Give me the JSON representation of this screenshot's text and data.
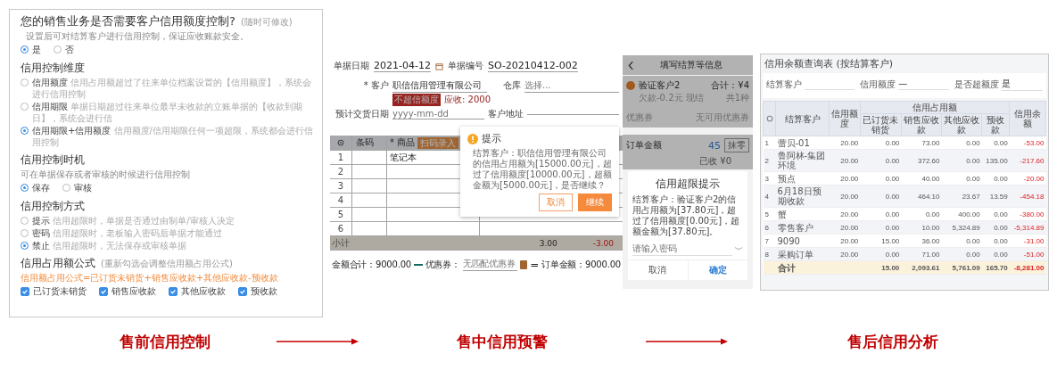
{
  "settings": {
    "title": "您的销售业务是否需要客户信用额度控制?",
    "title_hint": "(随时可修改)",
    "description": "设置后可对结算客户进行信用控制，保证应收账款安全。",
    "enable_options": [
      {
        "label": "是",
        "selected": true
      },
      {
        "label": "否",
        "selected": false
      }
    ],
    "sections": [
      {
        "kind": "radio_list",
        "heading": "信用控制维度",
        "options": [
          {
            "label": "信用额度",
            "description": "信用占用额超过了往来单位档案设置的【信用额度】，系统会进行信用控制",
            "selected": false
          },
          {
            "label": "信用期限",
            "description": "单据日期超过往来单位最早未收款的立账单据的【收款到期日】，系统会进行信",
            "selected": false
          },
          {
            "label": "信用期限+信用额度",
            "description": "信用额度/信用期限任何一项超限，系统都会进行信用控制",
            "selected": true
          }
        ]
      },
      {
        "kind": "radio_inline",
        "heading": "信用控制时机",
        "description": "可在单据保存或者审核的时候进行信用控制",
        "options": [
          {
            "label": "保存",
            "selected": true
          },
          {
            "label": "审核",
            "selected": false
          }
        ]
      },
      {
        "kind": "radio_list",
        "heading": "信用控制方式",
        "options": [
          {
            "label": "提示",
            "description": "信用超限时，单据是否通过由制单/审核人决定",
            "selected": false
          },
          {
            "label": "密码",
            "description": "信用超限时，老板输入密码后单据才能通过",
            "selected": false
          },
          {
            "label": "禁止",
            "description": "信用超限时，无法保存或审核单据",
            "selected": true
          }
        ]
      },
      {
        "kind": "checkbox_formula",
        "heading": "信用占用额公式",
        "heading_hint": "(重新勾选会调整信用额占用公式)",
        "formula": "信用额占用公式=已订货未销货+销售应收款+其他应收款-预收款",
        "options": [
          {
            "label": "已订货未销货",
            "checked": true
          },
          {
            "label": "销售应收款",
            "checked": true
          },
          {
            "label": "其他应收款",
            "checked": true
          },
          {
            "label": "预收款",
            "checked": true
          }
        ]
      }
    ]
  },
  "order_screen": {
    "date_label": "单据日期",
    "date": "2021-04-12",
    "number_label": "单据编号",
    "number": "SO-20210412-002",
    "customer_label": "* 客户",
    "customer": "职信信用管理有限公司",
    "credit_tag": "不超信额度",
    "receivable": "应收: 2000",
    "warehouse_label": "仓库",
    "warehouse_placeholder": "选择...",
    "delivery_label": "预计交货日期",
    "delivery_placeholder": "yyyy-mm-dd",
    "address_label": "客户地址",
    "columns": [
      "条码",
      "* 商品"
    ],
    "scan_button": "扫码录入",
    "rows": [
      {
        "index": "1",
        "product": "笔记本"
      },
      {
        "index": "2",
        "product": ""
      },
      {
        "index": "3",
        "product": ""
      },
      {
        "index": "4",
        "product": ""
      },
      {
        "index": "5",
        "product": ""
      },
      {
        "index": "6",
        "product": ""
      }
    ],
    "subtotal_label": "小计",
    "subtotal_values": [
      "3.00",
      "-3.00"
    ],
    "amount_total": "金额合计：9000.00",
    "coupon_label": "优惠券：",
    "coupon_placeholder": "无匹配优惠券",
    "equals": "=",
    "order_amount": "订单金额：9000.00",
    "dialog": {
      "title": "提示",
      "message": "结算客户：职信信用管理有限公司的信用占用额为[15000.00元]，超过了信用额度[10000.00元]，超额金额为[5000.00元]，是否继续？",
      "buttons": [
        {
          "label": "取消",
          "kind": "secondary"
        },
        {
          "label": "继续",
          "kind": "primary"
        }
      ]
    }
  },
  "mobile_screen": {
    "title": "填写结算等信息",
    "customer": "验证客户2",
    "customer_note": "欠款-0.2元 现结",
    "total": "合计：¥4",
    "count": "共1种",
    "coupon_label": "优惠券",
    "coupon_value": "无可用优惠券",
    "order_amount_label": "订单金额",
    "order_amount": "45",
    "round_button": "抹零",
    "received": "已收 ¥0",
    "dialog": {
      "title": "信用超限提示",
      "message": "结算客户：验证客户2的信用占用额为[37.80元]，超过了信用额度[0.00元]，超额金额为[37.80元]。",
      "password_placeholder": "请输入密码",
      "buttons": [
        {
          "label": "取消",
          "kind": "secondary"
        },
        {
          "label": "确定",
          "kind": "primary"
        }
      ]
    }
  },
  "report": {
    "title": "信用余额查询表 (按结算客户)",
    "filters": [
      {
        "label": "结算客户"
      },
      {
        "label": "信用额度",
        "value": "—"
      },
      {
        "label": "是否超额度",
        "value": "是"
      }
    ],
    "header_rows": [
      [
        {
          "label": "结算客户",
          "rowspan": 2
        },
        {
          "label": "信用额度",
          "rowspan": 2
        },
        {
          "label": "信用占用额",
          "colspan": 4
        },
        {
          "label": "信用余额",
          "rowspan": 2
        }
      ],
      [
        {
          "label": "已订货未销货"
        },
        {
          "label": "销售应收款"
        },
        {
          "label": "其他应收款"
        },
        {
          "label": "预收款"
        }
      ]
    ],
    "rows": [
      {
        "index": "1",
        "cells": [
          "蕾贝-01",
          "20.00",
          "0.00",
          "73.00",
          "0.00",
          "0.00",
          "-53.00"
        ]
      },
      {
        "index": "2",
        "cells": [
          "鲁阿林-集团环境",
          "20.00",
          "0.00",
          "372.60",
          "0.00",
          "135.00",
          "-217.60"
        ]
      },
      {
        "index": "3",
        "cells": [
          "预点",
          "20.00",
          "0.00",
          "40.00",
          "0.00",
          "0.00",
          "-20.00"
        ]
      },
      {
        "index": "4",
        "cells": [
          "6月18日预期收款",
          "20.00",
          "0.00",
          "464.10",
          "23.67",
          "13.59",
          "-454.18"
        ]
      },
      {
        "index": "5",
        "cells": [
          "蟹",
          "20.00",
          "0.00",
          "0.00",
          "400.00",
          "0.00",
          "-380.00"
        ]
      },
      {
        "index": "6",
        "cells": [
          "零售客户",
          "20.00",
          "0.00",
          "10.00",
          "5,324.89",
          "0.00",
          "-5,314.89"
        ]
      },
      {
        "index": "7",
        "cells": [
          "9090",
          "20.00",
          "15.00",
          "36.00",
          "0.00",
          "0.00",
          "-31.00"
        ]
      },
      {
        "index": "8",
        "cells": [
          "采购订单",
          "20.00",
          "0.00",
          "71.00",
          "0.00",
          "0.00",
          "-51.00"
        ]
      }
    ],
    "total_row": {
      "label": "合计",
      "cells": [
        "",
        "15.00",
        "2,093.61",
        "5,761.09",
        "165.70",
        "-8,281.00"
      ]
    }
  },
  "captions": [
    "售前信用控制",
    "售中信用预警",
    "售后信用分析"
  ]
}
